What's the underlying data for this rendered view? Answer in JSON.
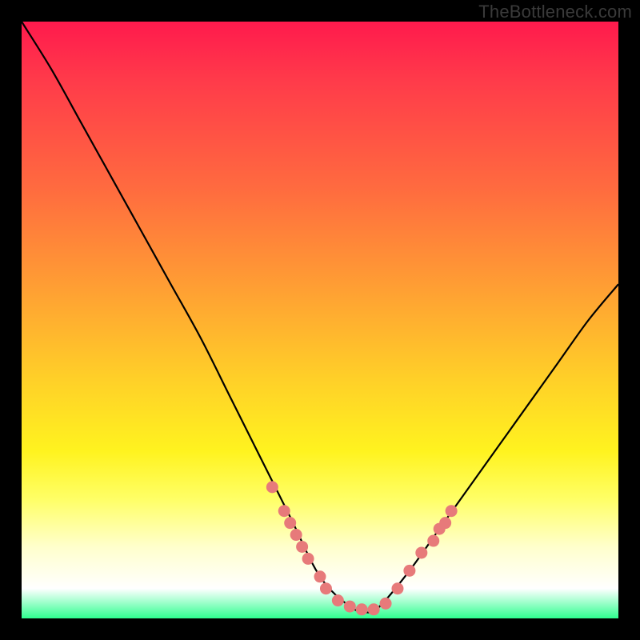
{
  "watermark": "TheBottleneck.com",
  "chart_data": {
    "type": "line",
    "title": "",
    "xlabel": "",
    "ylabel": "",
    "xlim": [
      0,
      100
    ],
    "ylim": [
      0,
      100
    ],
    "grid": false,
    "legend": false,
    "series": [
      {
        "name": "bottleneck-curve",
        "x": [
          0,
          5,
          10,
          15,
          20,
          25,
          30,
          35,
          40,
          45,
          50,
          55,
          58,
          60,
          65,
          70,
          75,
          80,
          85,
          90,
          95,
          100
        ],
        "y": [
          100,
          92,
          83,
          74,
          65,
          56,
          47,
          37,
          27,
          17,
          7,
          2,
          1,
          2,
          8,
          15,
          22,
          29,
          36,
          43,
          50,
          56
        ]
      }
    ],
    "markers": {
      "name": "highlight-dots",
      "color": "#e77a7a",
      "points": [
        {
          "x": 42,
          "y": 22
        },
        {
          "x": 44,
          "y": 18
        },
        {
          "x": 45,
          "y": 16
        },
        {
          "x": 46,
          "y": 14
        },
        {
          "x": 47,
          "y": 12
        },
        {
          "x": 48,
          "y": 10
        },
        {
          "x": 50,
          "y": 7
        },
        {
          "x": 51,
          "y": 5
        },
        {
          "x": 53,
          "y": 3
        },
        {
          "x": 55,
          "y": 2
        },
        {
          "x": 57,
          "y": 1.5
        },
        {
          "x": 59,
          "y": 1.5
        },
        {
          "x": 61,
          "y": 2.5
        },
        {
          "x": 63,
          "y": 5
        },
        {
          "x": 65,
          "y": 8
        },
        {
          "x": 67,
          "y": 11
        },
        {
          "x": 69,
          "y": 13
        },
        {
          "x": 70,
          "y": 15
        },
        {
          "x": 71,
          "y": 16
        },
        {
          "x": 72,
          "y": 18
        }
      ]
    },
    "background_gradient": {
      "top": "#ff1a4d",
      "mid": "#ffd028",
      "bottom": "#2fff8f"
    }
  }
}
